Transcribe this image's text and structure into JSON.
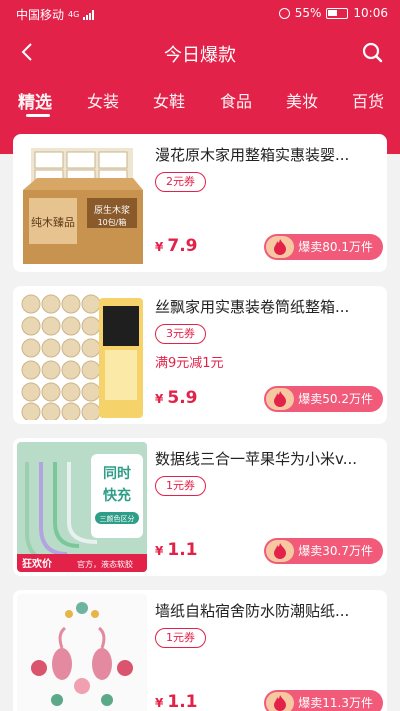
{
  "status": {
    "carrier": "中国移动",
    "network": "4G",
    "battery": "55%",
    "time": "10:06"
  },
  "nav": {
    "title": "今日爆款"
  },
  "tabs": [
    "精选",
    "女装",
    "女鞋",
    "食品",
    "美妆",
    "百货"
  ],
  "products": [
    {
      "title": "漫花原木家用整箱实惠装婴...",
      "coupon": "2元券",
      "promo": "",
      "currency": "¥",
      "price": "7.9",
      "sold": "爆卖80.1万件"
    },
    {
      "title": "丝飘家用实惠装卷筒纸整箱...",
      "coupon": "3元券",
      "promo": "满9元减1元",
      "currency": "¥",
      "price": "5.9",
      "sold": "爆卖50.2万件"
    },
    {
      "title": "数据线三合一苹果华为小米v...",
      "coupon": "1元券",
      "promo": "",
      "currency": "¥",
      "price": "1.1",
      "sold": "爆卖30.7万件"
    },
    {
      "title": "墙纸自粘宿舍防水防潮贴纸...",
      "coupon": "1元券",
      "promo": "",
      "currency": "¥",
      "price": "1.1",
      "sold": "爆卖11.3万件"
    }
  ],
  "images": {
    "box_text_1": "纯木臻品",
    "box_text_2": "原生木浆",
    "box_text_3": "10包/箱",
    "cable_text_1": "同时",
    "cable_text_2": "快充",
    "cable_text_3": "三颜色区分",
    "cable_badge": "狂欢价",
    "cable_tag": "官方，液态软胶"
  },
  "colors": {
    "brand": "#e3224a",
    "sold_pill": "#f25a7a"
  }
}
